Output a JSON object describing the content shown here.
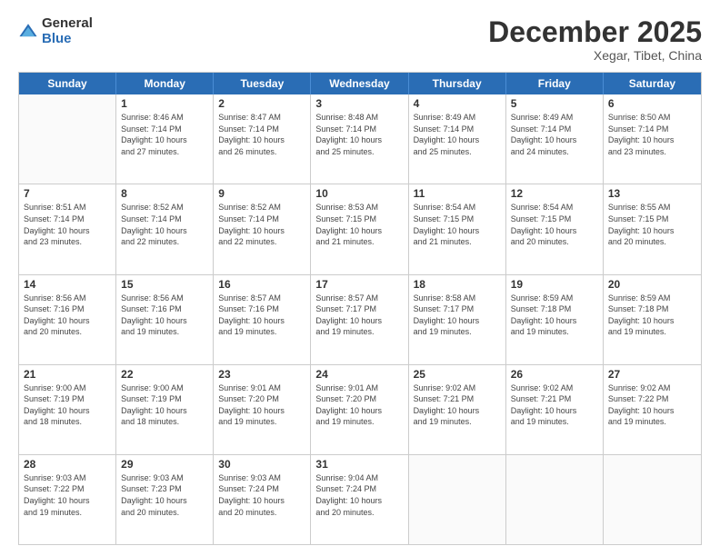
{
  "header": {
    "logo_general": "General",
    "logo_blue": "Blue",
    "title": "December 2025",
    "location": "Xegar, Tibet, China"
  },
  "weekdays": [
    "Sunday",
    "Monday",
    "Tuesday",
    "Wednesday",
    "Thursday",
    "Friday",
    "Saturday"
  ],
  "rows": [
    [
      {
        "day": "",
        "info": ""
      },
      {
        "day": "1",
        "info": "Sunrise: 8:46 AM\nSunset: 7:14 PM\nDaylight: 10 hours\nand 27 minutes."
      },
      {
        "day": "2",
        "info": "Sunrise: 8:47 AM\nSunset: 7:14 PM\nDaylight: 10 hours\nand 26 minutes."
      },
      {
        "day": "3",
        "info": "Sunrise: 8:48 AM\nSunset: 7:14 PM\nDaylight: 10 hours\nand 25 minutes."
      },
      {
        "day": "4",
        "info": "Sunrise: 8:49 AM\nSunset: 7:14 PM\nDaylight: 10 hours\nand 25 minutes."
      },
      {
        "day": "5",
        "info": "Sunrise: 8:49 AM\nSunset: 7:14 PM\nDaylight: 10 hours\nand 24 minutes."
      },
      {
        "day": "6",
        "info": "Sunrise: 8:50 AM\nSunset: 7:14 PM\nDaylight: 10 hours\nand 23 minutes."
      }
    ],
    [
      {
        "day": "7",
        "info": "Sunrise: 8:51 AM\nSunset: 7:14 PM\nDaylight: 10 hours\nand 23 minutes."
      },
      {
        "day": "8",
        "info": "Sunrise: 8:52 AM\nSunset: 7:14 PM\nDaylight: 10 hours\nand 22 minutes."
      },
      {
        "day": "9",
        "info": "Sunrise: 8:52 AM\nSunset: 7:14 PM\nDaylight: 10 hours\nand 22 minutes."
      },
      {
        "day": "10",
        "info": "Sunrise: 8:53 AM\nSunset: 7:15 PM\nDaylight: 10 hours\nand 21 minutes."
      },
      {
        "day": "11",
        "info": "Sunrise: 8:54 AM\nSunset: 7:15 PM\nDaylight: 10 hours\nand 21 minutes."
      },
      {
        "day": "12",
        "info": "Sunrise: 8:54 AM\nSunset: 7:15 PM\nDaylight: 10 hours\nand 20 minutes."
      },
      {
        "day": "13",
        "info": "Sunrise: 8:55 AM\nSunset: 7:15 PM\nDaylight: 10 hours\nand 20 minutes."
      }
    ],
    [
      {
        "day": "14",
        "info": "Sunrise: 8:56 AM\nSunset: 7:16 PM\nDaylight: 10 hours\nand 20 minutes."
      },
      {
        "day": "15",
        "info": "Sunrise: 8:56 AM\nSunset: 7:16 PM\nDaylight: 10 hours\nand 19 minutes."
      },
      {
        "day": "16",
        "info": "Sunrise: 8:57 AM\nSunset: 7:16 PM\nDaylight: 10 hours\nand 19 minutes."
      },
      {
        "day": "17",
        "info": "Sunrise: 8:57 AM\nSunset: 7:17 PM\nDaylight: 10 hours\nand 19 minutes."
      },
      {
        "day": "18",
        "info": "Sunrise: 8:58 AM\nSunset: 7:17 PM\nDaylight: 10 hours\nand 19 minutes."
      },
      {
        "day": "19",
        "info": "Sunrise: 8:59 AM\nSunset: 7:18 PM\nDaylight: 10 hours\nand 19 minutes."
      },
      {
        "day": "20",
        "info": "Sunrise: 8:59 AM\nSunset: 7:18 PM\nDaylight: 10 hours\nand 19 minutes."
      }
    ],
    [
      {
        "day": "21",
        "info": "Sunrise: 9:00 AM\nSunset: 7:19 PM\nDaylight: 10 hours\nand 18 minutes."
      },
      {
        "day": "22",
        "info": "Sunrise: 9:00 AM\nSunset: 7:19 PM\nDaylight: 10 hours\nand 18 minutes."
      },
      {
        "day": "23",
        "info": "Sunrise: 9:01 AM\nSunset: 7:20 PM\nDaylight: 10 hours\nand 19 minutes."
      },
      {
        "day": "24",
        "info": "Sunrise: 9:01 AM\nSunset: 7:20 PM\nDaylight: 10 hours\nand 19 minutes."
      },
      {
        "day": "25",
        "info": "Sunrise: 9:02 AM\nSunset: 7:21 PM\nDaylight: 10 hours\nand 19 minutes."
      },
      {
        "day": "26",
        "info": "Sunrise: 9:02 AM\nSunset: 7:21 PM\nDaylight: 10 hours\nand 19 minutes."
      },
      {
        "day": "27",
        "info": "Sunrise: 9:02 AM\nSunset: 7:22 PM\nDaylight: 10 hours\nand 19 minutes."
      }
    ],
    [
      {
        "day": "28",
        "info": "Sunrise: 9:03 AM\nSunset: 7:22 PM\nDaylight: 10 hours\nand 19 minutes."
      },
      {
        "day": "29",
        "info": "Sunrise: 9:03 AM\nSunset: 7:23 PM\nDaylight: 10 hours\nand 20 minutes."
      },
      {
        "day": "30",
        "info": "Sunrise: 9:03 AM\nSunset: 7:24 PM\nDaylight: 10 hours\nand 20 minutes."
      },
      {
        "day": "31",
        "info": "Sunrise: 9:04 AM\nSunset: 7:24 PM\nDaylight: 10 hours\nand 20 minutes."
      },
      {
        "day": "",
        "info": ""
      },
      {
        "day": "",
        "info": ""
      },
      {
        "day": "",
        "info": ""
      }
    ]
  ]
}
